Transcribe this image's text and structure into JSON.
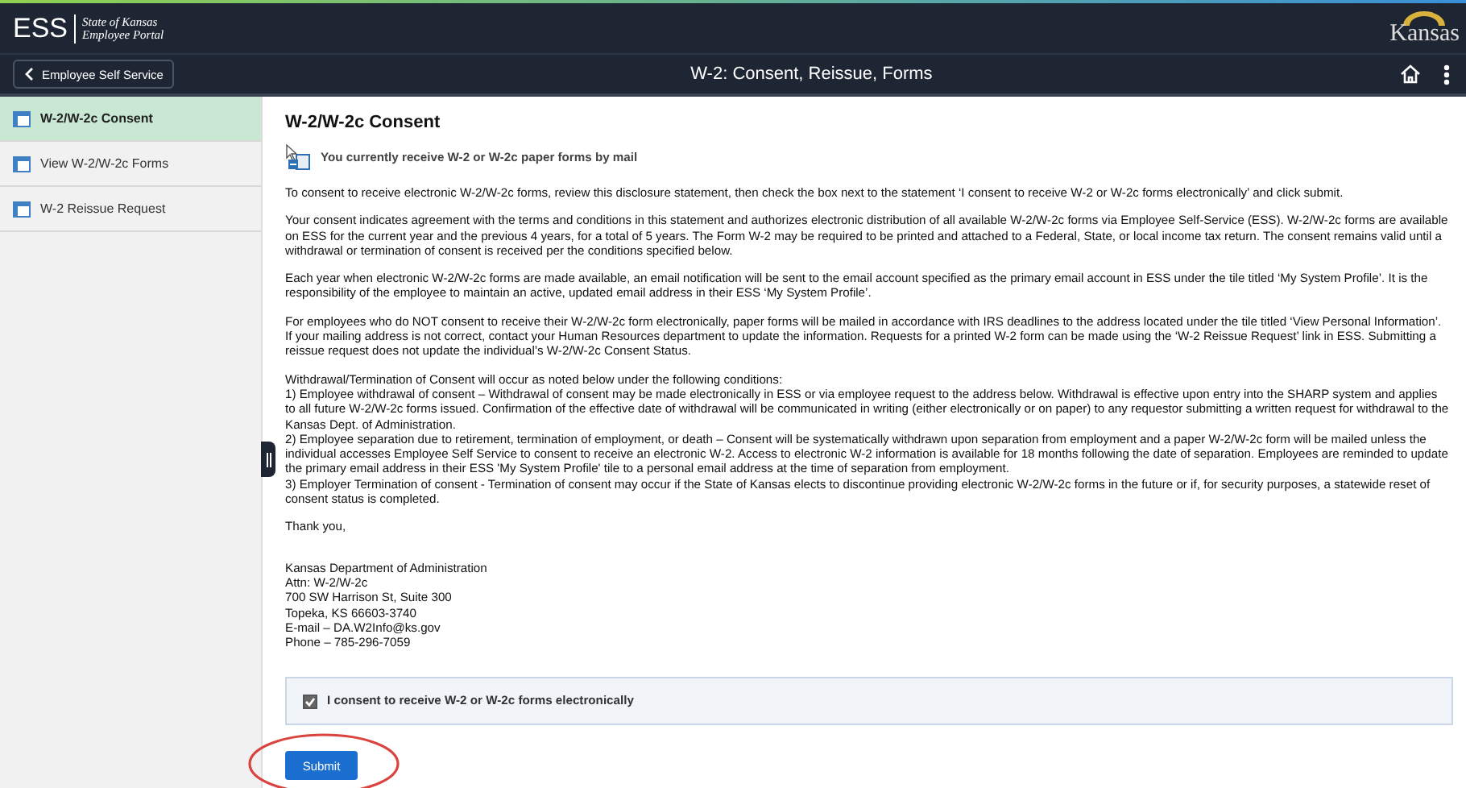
{
  "header": {
    "logo": "ESS",
    "subtitle_line_1": "State of Kansas",
    "subtitle_line_2": "Employee Portal",
    "brand": "Kansas"
  },
  "nav_bar": {
    "back_button": "Employee Self Service",
    "title": "W-2: Consent, Reissue, Forms"
  },
  "sidebar": {
    "items": [
      {
        "label": "W-2/W-2c Consent",
        "selected": true
      },
      {
        "label": "View W-2/W-2c Forms",
        "selected": false
      },
      {
        "label": "W-2 Reissue Request",
        "selected": false
      }
    ]
  },
  "content": {
    "heading": "W-2/W-2c Consent",
    "status_message": "You currently receive W-2 or W-2c paper forms by mail",
    "paragraphs": [
      "To consent to receive electronic W-2/W-2c forms, review this disclosure statement, then check the box next to the statement ‘I consent to receive W-2 or W-2c forms electronically’ and click submit.",
      "Your consent indicates agreement with the terms and conditions in this statement and authorizes electronic distribution of all available W-2/W-2c forms via Employee Self-Service (ESS). W-2/W-2c forms are available on ESS for the current year and the previous 4 years, for a total of 5 years. The Form W-2 may be required to be printed and attached to a Federal, State, or local income tax return.  The consent remains valid until a withdrawal or termination of consent is received per the conditions specified below.",
      "Each year when electronic W-2/W-2c forms are made available, an email notification will be sent to the email account specified as the primary email account in ESS under the tile titled ‘My System Profile’.  It is the responsibility of the employee to maintain an active, updated email address in their ESS ‘My System Profile’.",
      "For employees who do NOT consent to receive their W-2/W-2c form electronically, paper forms will be mailed in accordance with IRS deadlines to the address located under the tile titled ‘View Personal Information’.  If your mailing address is not correct, contact your Human Resources department to update the information.  Requests for a printed W-2 form can be made using the ‘W-2 Reissue Request’ link in ESS.  Submitting a reissue request does not update the individual’s W-2/W-2c Consent Status."
    ],
    "conditions": [
      "Withdrawal/Termination of Consent will occur as noted below under the following conditions:",
      "1) Employee withdrawal of consent – Withdrawal of consent may be made electronically in ESS or via employee request to the address below.  Withdrawal is effective upon entry into the SHARP system and applies to all future W-2/W-2c forms issued.  Confirmation of the effective date of withdrawal will be communicated in writing (either electronically or on paper) to any requestor submitting a written request for withdrawal to the Kansas Dept. of Administration.",
      "2) Employee separation due to retirement, termination of employment, or death – Consent will be systematically withdrawn upon separation from employment and a paper W-2/W-2c form will be mailed unless the individual accesses Employee Self Service to consent to receive an electronic W-2.  Access to electronic W-2 information is available for 18 months following the date of separation.  Employees are reminded to update the primary email address in their ESS 'My System Profile' tile to a personal email address at the time of separation from employment.",
      "3) Employer Termination of consent - Termination of consent may occur if the State of Kansas elects to discontinue providing electronic W-2/W-2c forms in the future or if, for security purposes, a statewide reset of consent status is completed."
    ],
    "closing": "Thank you,",
    "address": [
      "Kansas Department of Administration",
      "Attn: W-2/W-2c",
      "700 SW Harrison St, Suite 300",
      "Topeka, KS  66603-3740",
      "E-mail – DA.W2Info@ks.gov",
      "Phone – 785-296-7059"
    ],
    "consent_checkbox": {
      "label": "I consent to receive W-2 or W-2c forms electronically",
      "checked": true
    },
    "submit_button": "Submit"
  }
}
